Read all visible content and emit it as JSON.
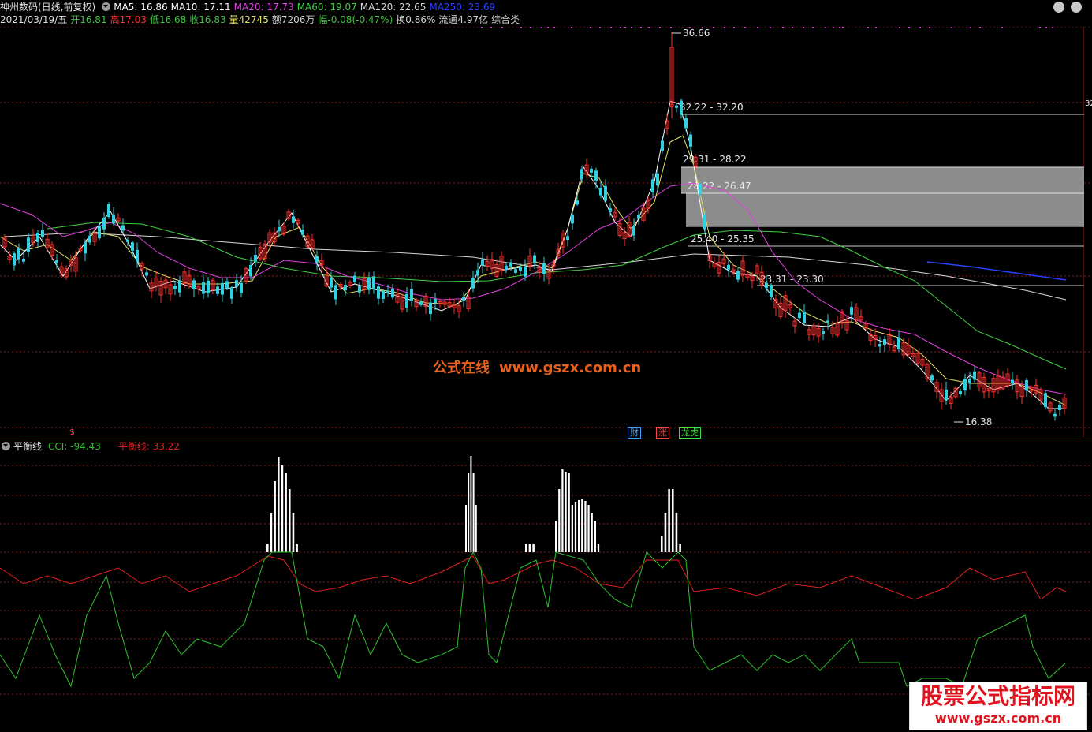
{
  "header": {
    "stock_name": "神州数码(日线,前复权)",
    "ma": [
      {
        "label": "MA5: 16.86",
        "color": "#ffffff"
      },
      {
        "label": "MA10: 17.11",
        "color": "#ffffff"
      },
      {
        "label": "MA20: 17.73",
        "color": "#e040e0"
      },
      {
        "label": "MA60: 19.07",
        "color": "#40d040"
      },
      {
        "label": "MA120: 22.65",
        "color": "#d8d8d8"
      },
      {
        "label": "MA250: 23.69",
        "color": "#2a40ff"
      }
    ],
    "date": "2021/03/19/五",
    "quote": [
      {
        "label": "开16.81",
        "color": "#40c040"
      },
      {
        "label": "高17.03",
        "color": "#ff3030"
      },
      {
        "label": "低16.68",
        "color": "#40c040"
      },
      {
        "label": "收16.83",
        "color": "#40c040"
      },
      {
        "label": "量42745",
        "color": "#e0e060"
      },
      {
        "label": "额7206万",
        "color": "#d0d0d0"
      },
      {
        "label": "幅-0.08(-0.47%)",
        "color": "#40c040"
      },
      {
        "label": "换0.86%",
        "color": "#d0d0d0"
      },
      {
        "label": "流通4.97亿",
        "color": "#d0d0d0"
      },
      {
        "label": "综合类",
        "color": "#d0d0d0"
      }
    ]
  },
  "main_chart": {
    "price_labels": {
      "high": "36.66",
      "low": "16.38",
      "axis_tick": "32"
    },
    "zones": [
      {
        "label": "32.22 - 32.20"
      },
      {
        "label": "29.31 - 28.22"
      },
      {
        "label": "28.22 - 26.47"
      },
      {
        "label": "25.40 - 25.35"
      },
      {
        "label": "23.31 - 23.30"
      }
    ],
    "event_tags": [
      {
        "label": "财",
        "color": "#40a0ff"
      },
      {
        "label": "涨",
        "color": "#ff4040"
      },
      {
        "label": "龙虎",
        "color": "#40e040"
      }
    ],
    "dollar_tag": "$"
  },
  "sub_chart": {
    "title": "平衡线",
    "cci_label": "CCI: -94.43",
    "balance_label": "平衡线: 33.22",
    "colors": {
      "cci": "#30c030",
      "balance": "#e02020"
    }
  },
  "watermark": {
    "cn": "公式在线",
    "url": "www.gszx.com.cn"
  },
  "logo": {
    "title": "股票公式指标网",
    "url": "www.gszx.com.cn"
  },
  "colors": {
    "up": "#ff3030",
    "down": "#30d0e0",
    "grid": "#8a1a1a",
    "divider": "#a01818"
  }
}
